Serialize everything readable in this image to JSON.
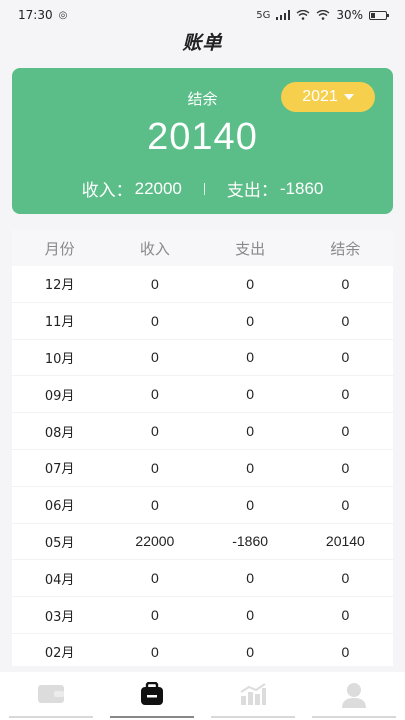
{
  "status_bar": {
    "time": "17:30",
    "signal_label": "5G",
    "battery": "30%"
  },
  "header": {
    "title": "账单"
  },
  "summary": {
    "year": "2021",
    "balance_label": "结余",
    "balance_value": "20140",
    "income_label": "收入：",
    "income_value": "22000",
    "expense_label": "支出：",
    "expense_value": "-1860"
  },
  "table": {
    "columns": [
      "月份",
      "收入",
      "支出",
      "结余"
    ],
    "rows": [
      [
        "12月",
        "0",
        "0",
        "0"
      ],
      [
        "11月",
        "0",
        "0",
        "0"
      ],
      [
        "10月",
        "0",
        "0",
        "0"
      ],
      [
        "09月",
        "0",
        "0",
        "0"
      ],
      [
        "08月",
        "0",
        "0",
        "0"
      ],
      [
        "07月",
        "0",
        "0",
        "0"
      ],
      [
        "06月",
        "0",
        "0",
        "0"
      ],
      [
        "05月",
        "22000",
        "-1860",
        "20140"
      ],
      [
        "04月",
        "0",
        "0",
        "0"
      ],
      [
        "03月",
        "0",
        "0",
        "0"
      ],
      [
        "02月",
        "0",
        "0",
        "0"
      ]
    ]
  },
  "tab_bar": {
    "items": [
      {
        "icon": "wallet-icon",
        "active": false
      },
      {
        "icon": "bill-icon",
        "active": true
      },
      {
        "icon": "chart-icon",
        "active": false
      },
      {
        "icon": "user-icon",
        "active": false
      }
    ]
  },
  "colors": {
    "card": "#5bbd88",
    "year_pill": "#f6cf4d",
    "active_icon": "#111111",
    "inactive_icon": "#dcdcdc"
  }
}
